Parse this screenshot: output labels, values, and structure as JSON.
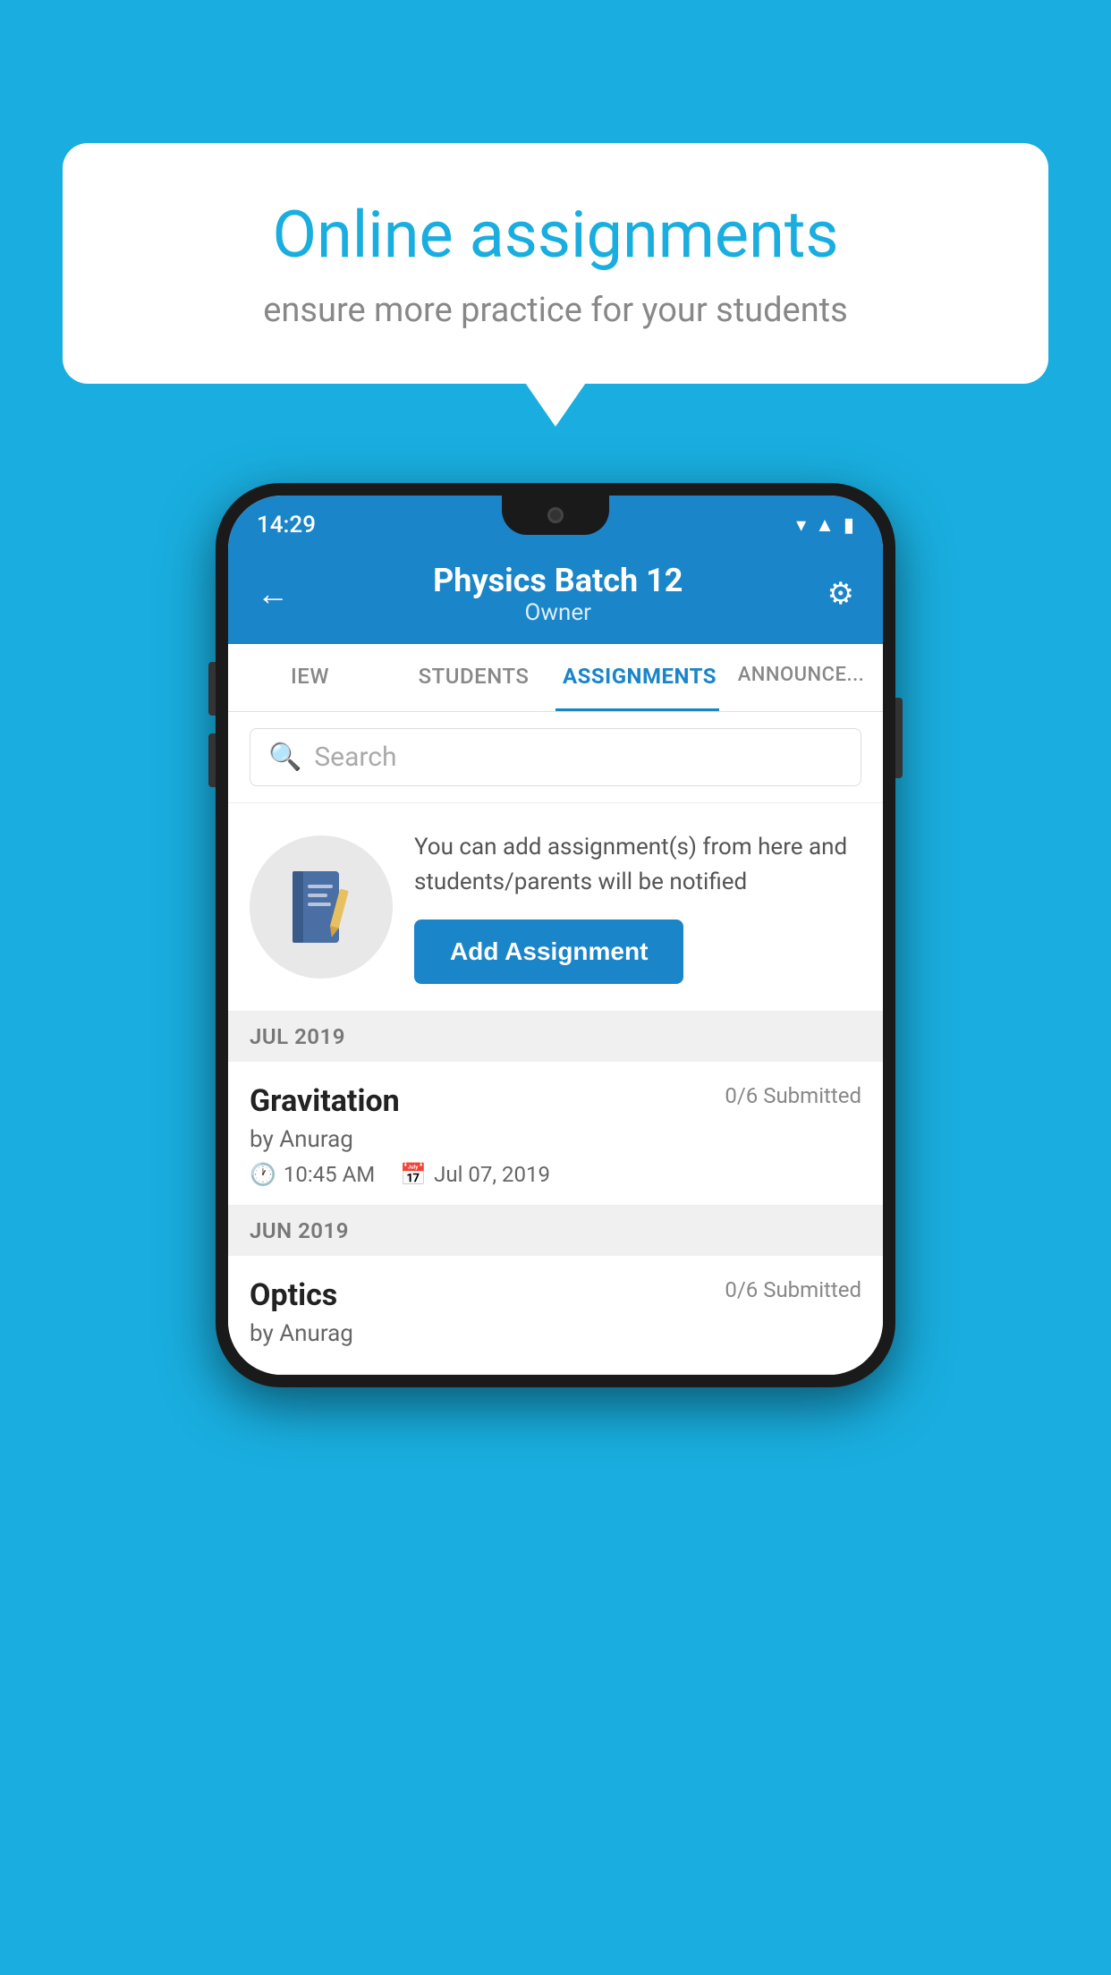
{
  "background": {
    "color": "#19AEDF"
  },
  "speech_bubble": {
    "title": "Online assignments",
    "subtitle": "ensure more practice for your students"
  },
  "status_bar": {
    "time": "14:29",
    "icons": [
      "wifi",
      "signal",
      "battery"
    ]
  },
  "header": {
    "title": "Physics Batch 12",
    "subtitle": "Owner",
    "back_label": "←",
    "settings_label": "⚙"
  },
  "tabs": [
    {
      "label": "IEW",
      "active": false
    },
    {
      "label": "STUDENTS",
      "active": false
    },
    {
      "label": "ASSIGNMENTS",
      "active": true
    },
    {
      "label": "ANNOUNCEM...",
      "active": false
    }
  ],
  "search": {
    "placeholder": "Search"
  },
  "info_section": {
    "description": "You can add assignment(s) from here and students/parents will be notified",
    "button_label": "Add Assignment"
  },
  "sections": [
    {
      "header": "JUL 2019",
      "assignments": [
        {
          "name": "Gravitation",
          "status": "0/6 Submitted",
          "author": "by Anurag",
          "time": "10:45 AM",
          "date": "Jul 07, 2019"
        }
      ]
    },
    {
      "header": "JUN 2019",
      "assignments": [
        {
          "name": "Optics",
          "status": "0/6 Submitted",
          "author": "by Anurag",
          "time": "",
          "date": ""
        }
      ]
    }
  ]
}
